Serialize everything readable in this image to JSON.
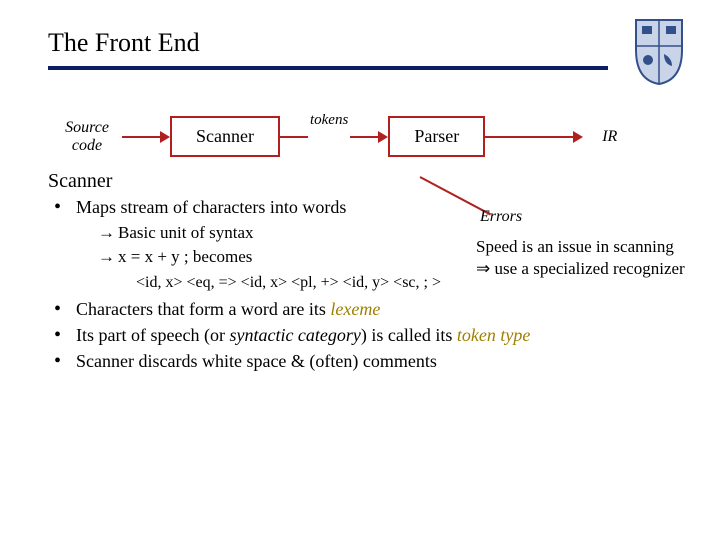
{
  "title": "The Front End",
  "crest": {
    "name": "university-crest"
  },
  "diagram": {
    "source_label_line1": "Source",
    "source_label_line2": "code",
    "scanner_box": "Scanner",
    "tokens_label": "tokens",
    "parser_box": "Parser",
    "ir_label": "IR",
    "errors_label": "Errors"
  },
  "section_head": "Scanner",
  "bullets": {
    "b1": "Maps stream of characters into words",
    "b1a": "Basic unit of syntax",
    "b1b": "x = x + y ; becomes",
    "b1b_tokens": "<id, x> <eq, => <id, x> <pl, +> <id, y> <sc, ; >",
    "b2_pre": "Characters that form a word are its ",
    "b2_lex": "lexeme",
    "b3_pre": "Its part of speech (or ",
    "b3_syn": "syntactic category",
    "b3_mid": ") is called its ",
    "b3_tok": "token type",
    "b4": "Scanner discards white space & (often) comments"
  },
  "aside": {
    "line1": "Speed is an issue in scanning",
    "arrow": "⇒",
    "line2": " use a specialized recognizer"
  }
}
